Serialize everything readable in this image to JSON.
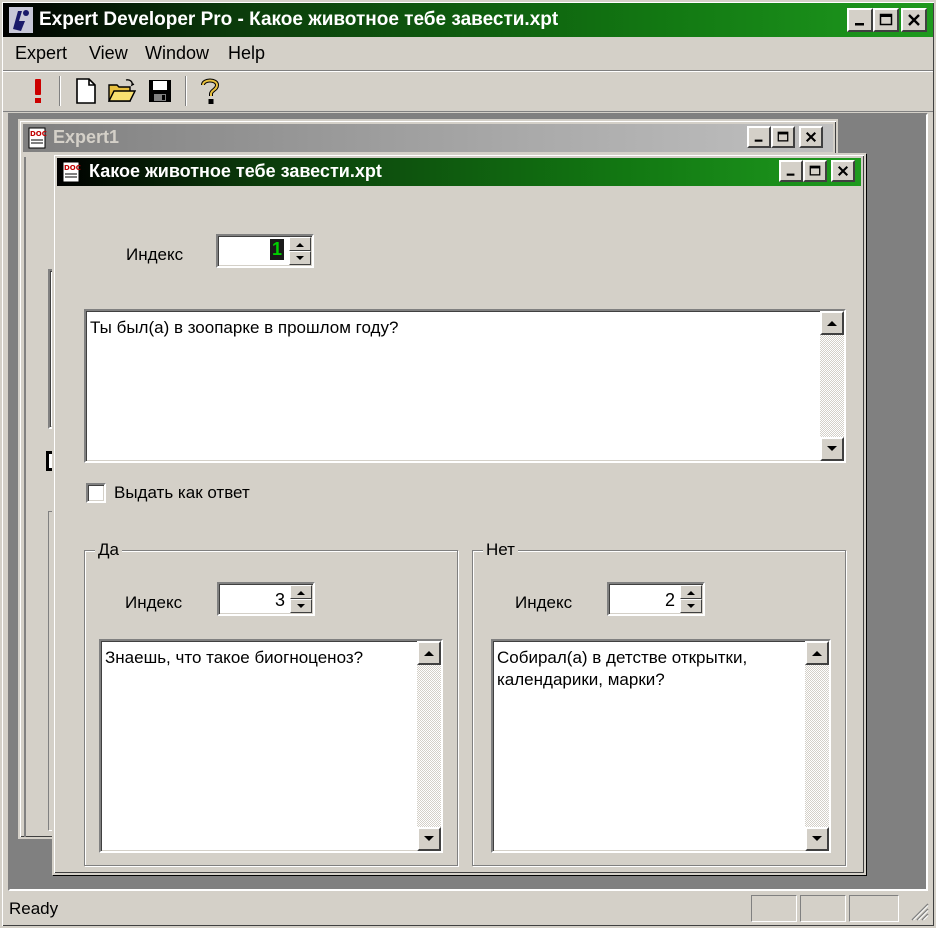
{
  "app": {
    "title": "Expert Developer Pro - Какое животное тебе завести.xpt"
  },
  "menu": {
    "items": [
      {
        "label": "Expert"
      },
      {
        "label": "View"
      },
      {
        "label": "Window"
      },
      {
        "label": "Help"
      }
    ]
  },
  "toolbar": {
    "buttons": [
      "run-icon",
      "new-file-icon",
      "open-folder-icon",
      "save-icon",
      "help-icon"
    ]
  },
  "expert1_window": {
    "title": "Expert1"
  },
  "doc_window": {
    "title": "Какое животное тебе завести.xpt",
    "index_label": "Индекс",
    "index_value": "1",
    "question": "Ты был(а) в зоопарке в прошлом году?",
    "answer_checkbox_label": "Выдать как ответ",
    "answer_checked": false,
    "yes_group": {
      "title": "Да",
      "index_label": "Индекс",
      "index_value": "3",
      "text": "Знаешь, что такое биогноценоз?"
    },
    "no_group": {
      "title": "Нет",
      "index_label": "Индекс",
      "index_value": "2",
      "text_line1": "Собирал(а) в детстве открытки,",
      "text_line2": "календарики, марки?"
    }
  },
  "status": {
    "text": "Ready"
  },
  "colors": {
    "active_title_start": "#000000",
    "active_title_end": "#1e9a1e",
    "face": "#d4d0c8",
    "mdi_background": "#808080"
  }
}
